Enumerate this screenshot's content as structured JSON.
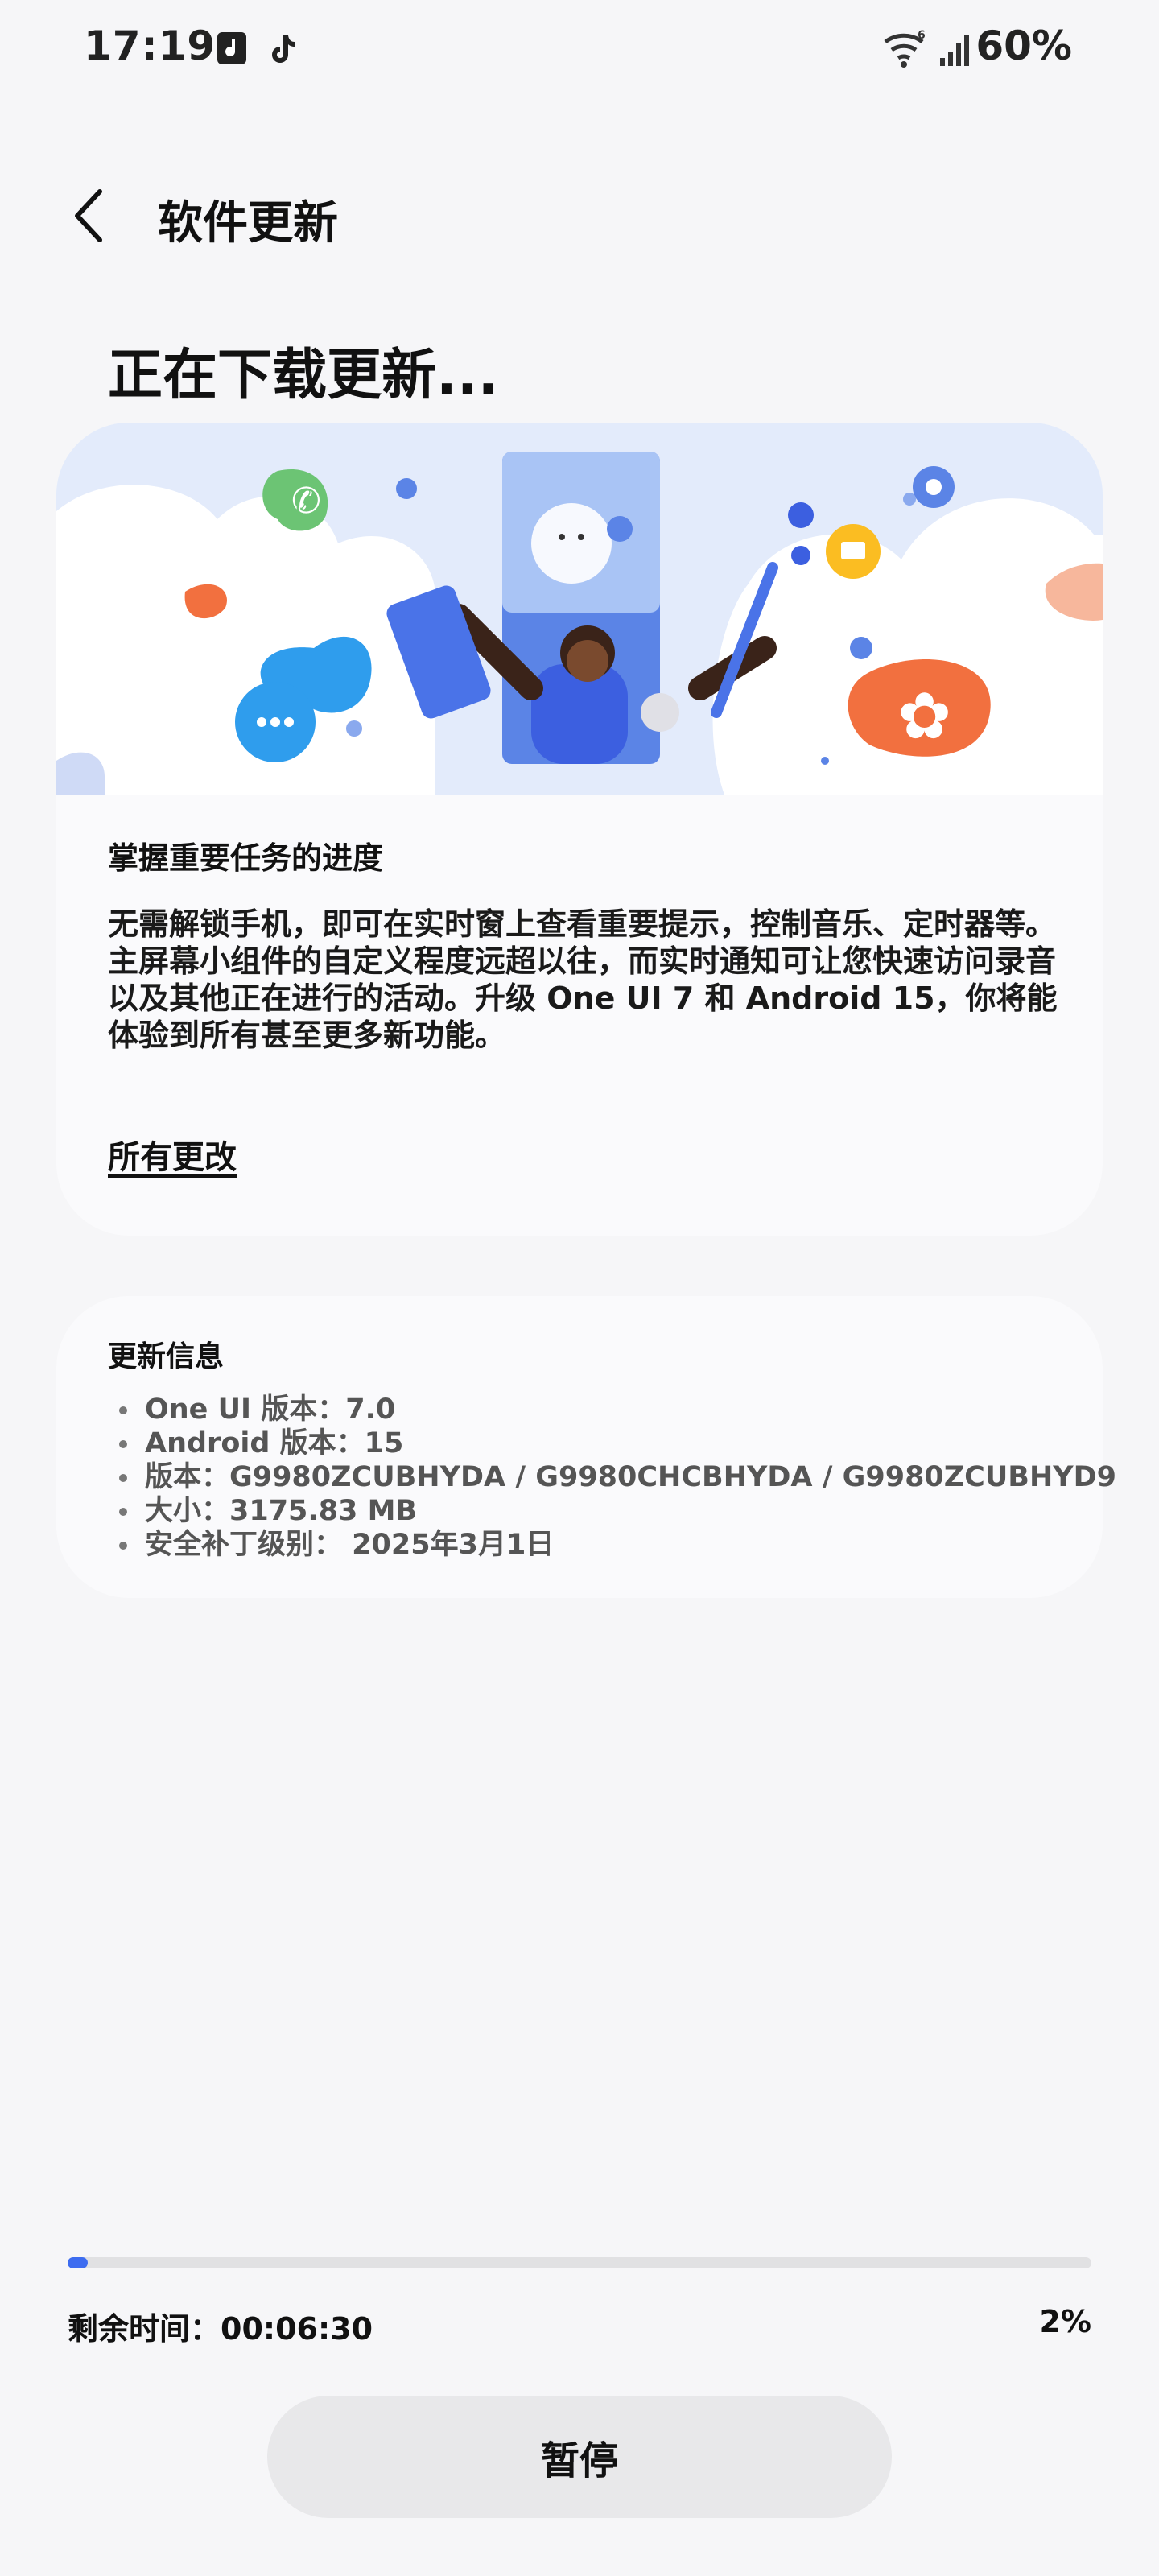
{
  "status_bar": {
    "time": "17:19",
    "battery": "60%",
    "icons": [
      "tiktok-music-icon",
      "tiktok-icon",
      "wifi-icon",
      "signal-icon"
    ]
  },
  "header": {
    "back_icon": "chevron-left-icon",
    "title": "软件更新"
  },
  "headline": "正在下载更新...",
  "feature_card": {
    "heading": "掌握重要任务的进度",
    "body": "无需解锁手机，即可在实时窗上查看重要提示，控制音乐、定时器等。主屏幕小组件的自定义程度远超以往，而实时通知可让您快速访问录音以及其他正在进行的活动。升级 One UI 7 和 Android 15，你将能体验到所有甚至更多新功能。",
    "link": "所有更改"
  },
  "update_info": {
    "heading": "更新信息",
    "items": [
      "One UI 版本：7.0",
      "Android 版本：15",
      "版本：G9980ZCUBHYDA / G9980CHCBHYDA / G9980ZCUBHYD9",
      "大小：3175.83 MB",
      "安全补丁级别： 2025年3月1日"
    ]
  },
  "progress": {
    "value_percent": 2,
    "remaining_label": "剩余时间：00:06:30",
    "percent_label": "2%"
  },
  "pause_button": "暂停",
  "colors": {
    "accent": "#3d6cf0",
    "background": "#f6f6f8",
    "card": "#fafafc"
  }
}
